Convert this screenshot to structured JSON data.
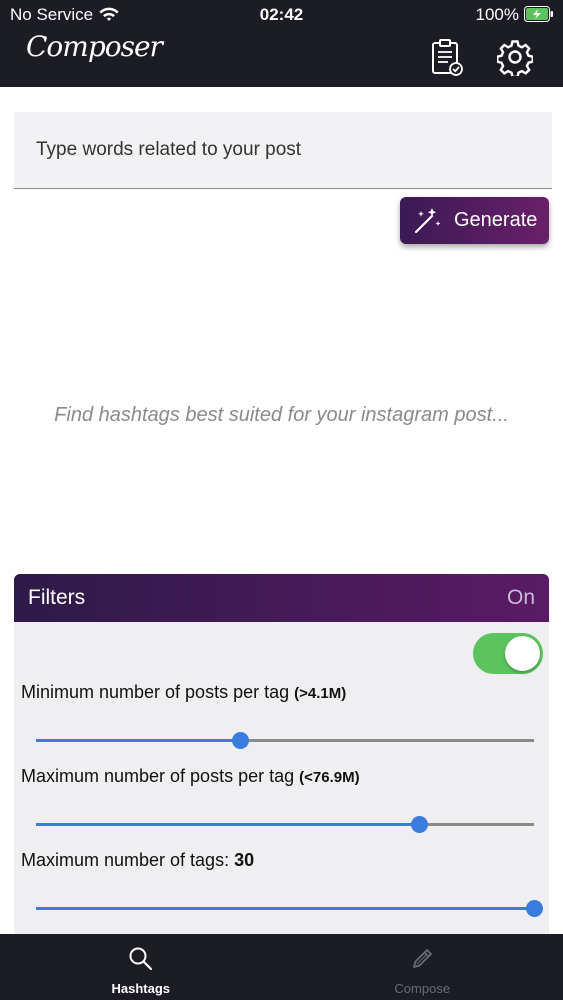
{
  "status_bar": {
    "carrier": "No Service",
    "time": "02:42",
    "battery": "100%"
  },
  "header": {
    "app_name": "Composer",
    "icons": [
      "clipboard-check-icon",
      "gear-icon"
    ]
  },
  "search": {
    "placeholder": "Type words related to your post",
    "value": ""
  },
  "generate": {
    "label": "Generate",
    "icon": "magic-wand-icon"
  },
  "empty_state": {
    "text": "Find hashtags best suited for your instagram post..."
  },
  "filters": {
    "title": "Filters",
    "state": "On",
    "enabled": true,
    "min_posts": {
      "label": "Minimum number of posts per tag ",
      "value": "(>4.1M)",
      "position": 0.41
    },
    "max_posts": {
      "label": "Maximum number of posts per tag ",
      "value": "(<76.9M)",
      "position": 0.77
    },
    "max_tags": {
      "label": "Maximum number of tags: ",
      "value": "30",
      "position": 1.0
    }
  },
  "tabs": [
    {
      "label": "Hashtags",
      "icon": "search-icon",
      "active": true
    },
    {
      "label": "Compose",
      "icon": "pencil-icon",
      "active": false
    }
  ],
  "colors": {
    "header_bg": "#1c1c24",
    "accent_purple": "#5a1a66",
    "slider_blue": "#3a7be0",
    "toggle_green": "#5cc45f"
  }
}
